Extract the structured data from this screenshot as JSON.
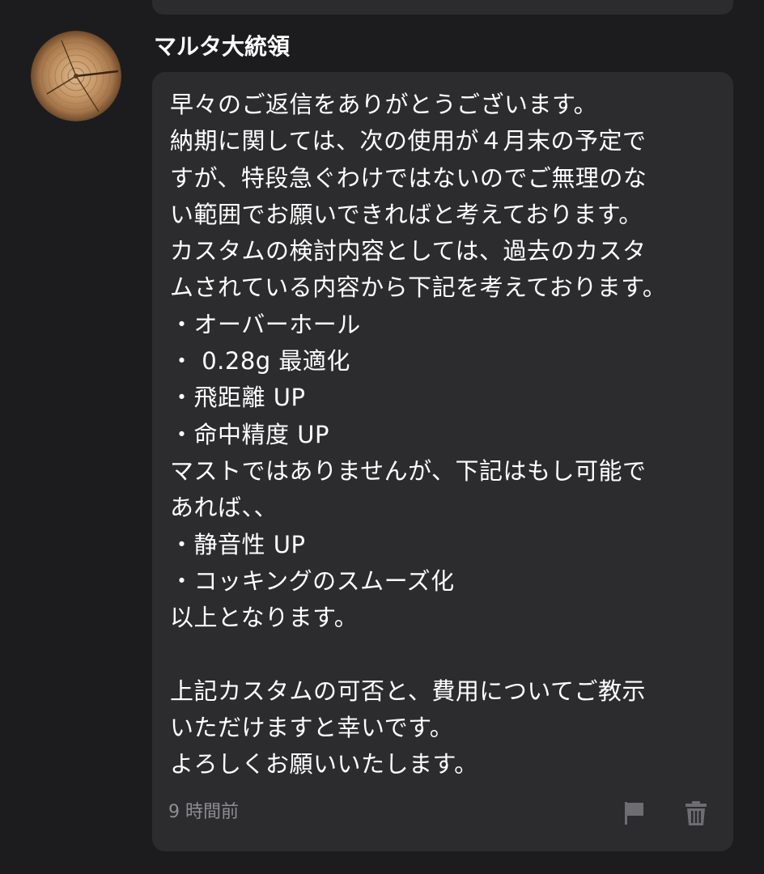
{
  "comment": {
    "username": "マルタ大統領",
    "message_lines": [
      "早々のご返信をありがとうございます。",
      "納期に関しては、次の使用が４月末の予定で",
      "すが、特段急ぐわけではないのでご無理のな",
      "い範囲でお願いできればと考えております。",
      "カスタムの検討内容としては、過去のカスタ",
      "ムされている内容から下記を考えております。",
      "・オーバーホール",
      "・ 0.28g 最適化",
      "・飛距離 UP",
      "・命中精度 UP",
      "マストではありませんが、下記はもし可能で",
      "あれば、、",
      "・静音性 UP",
      "・コッキングのスムーズ化",
      "以上となります。",
      "",
      "上記カスタムの可否と、費用についてご教示",
      "いただけますと幸いです。",
      "よろしくお願いいたします。"
    ],
    "timestamp": "9 時間前",
    "actions": {
      "report_icon": "flag-icon",
      "delete_icon": "trash-icon"
    }
  },
  "colors": {
    "background": "#1c1c1e",
    "bubble": "#2c2c2e",
    "text": "#ffffff",
    "muted": "#8e8e93",
    "icon": "#6d6d72"
  }
}
